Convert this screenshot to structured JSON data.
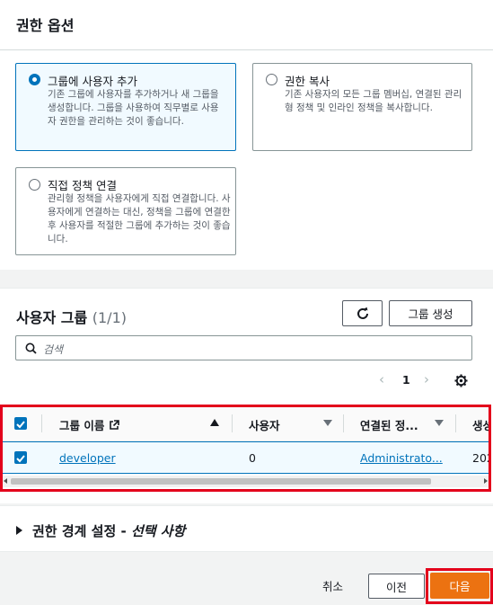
{
  "permissions": {
    "title": "권한 옵션",
    "options": [
      {
        "title": "그룹에 사용자 추가",
        "desc": "기존 그룹에 사용자를 추가하거나 새 그룹을 생성합니다. 그룹을 사용하여 직무별로 사용자 권한을 관리하는 것이 좋습니다.",
        "selected": true
      },
      {
        "title": "권한 복사",
        "desc": "기존 사용자의 모든 그룹 멤버십, 연결된 관리형 정책 및 인라인 정책을 복사합니다.",
        "selected": false
      },
      {
        "title": "직접 정책 연결",
        "desc": "관리형 정책을 사용자에게 직접 연결합니다. 사용자에게 연결하는 대신, 정책을 그룹에 연결한 후 사용자를 적절한 그룹에 추가하는 것이 좋습니다.",
        "selected": false
      }
    ]
  },
  "groups": {
    "title": "사용자 그룹",
    "count": "(1/1)",
    "refresh_icon": "refresh-icon",
    "create_button": "그룹 생성",
    "search_placeholder": "검색",
    "page_number": "1",
    "columns": {
      "name": "그룹 이름",
      "users": "사용자",
      "policies": "연결된 정...",
      "created": "생성"
    },
    "rows": [
      {
        "name": "developer",
        "users": "0",
        "policies": "Administrato...",
        "created": "202"
      }
    ]
  },
  "boundary": {
    "title": "권한 경계 설정 -",
    "optional": "선택 사항"
  },
  "footer": {
    "cancel": "취소",
    "previous": "이전",
    "next": "다음"
  },
  "colors": {
    "accent": "#0073bb",
    "primary": "#ec7211",
    "highlight": "#e3001b"
  }
}
